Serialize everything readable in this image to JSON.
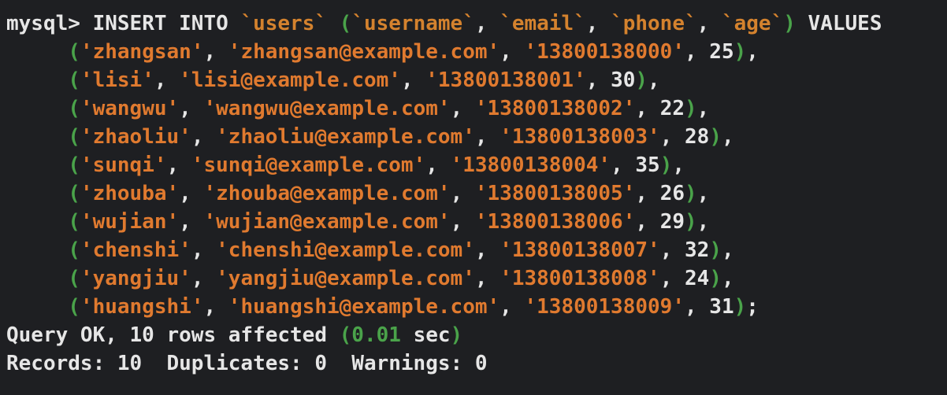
{
  "terminal": {
    "prompt": "mysql>",
    "statement": {
      "insert_keyword": "INSERT INTO",
      "table": "`users`",
      "columns": [
        "`username`",
        "`email`",
        "`phone`",
        "`age`"
      ],
      "values_keyword": "VALUES",
      "continuation": "->",
      "rows": [
        {
          "username": "'zhangsan'",
          "email": "'zhangsan@example.com'",
          "phone": "'13800138000'",
          "age": "25",
          "end": ","
        },
        {
          "username": "'lisi'",
          "email": "'lisi@example.com'",
          "phone": "'13800138001'",
          "age": "30",
          "end": ","
        },
        {
          "username": "'wangwu'",
          "email": "'wangwu@example.com'",
          "phone": "'13800138002'",
          "age": "22",
          "end": ","
        },
        {
          "username": "'zhaoliu'",
          "email": "'zhaoliu@example.com'",
          "phone": "'13800138003'",
          "age": "28",
          "end": ","
        },
        {
          "username": "'sunqi'",
          "email": "'sunqi@example.com'",
          "phone": "'13800138004'",
          "age": "35",
          "end": ","
        },
        {
          "username": "'zhouba'",
          "email": "'zhouba@example.com'",
          "phone": "'13800138005'",
          "age": "26",
          "end": ","
        },
        {
          "username": "'wujian'",
          "email": "'wujian@example.com'",
          "phone": "'13800138006'",
          "age": "29",
          "end": ","
        },
        {
          "username": "'chenshi'",
          "email": "'chenshi@example.com'",
          "phone": "'13800138007'",
          "age": "32",
          "end": ","
        },
        {
          "username": "'yangjiu'",
          "email": "'yangjiu@example.com'",
          "phone": "'13800138008'",
          "age": "24",
          "end": ","
        },
        {
          "username": "'huangshi'",
          "email": "'huangshi@example.com'",
          "phone": "'13800138009'",
          "age": "31",
          "end": ";"
        }
      ]
    },
    "result": {
      "query_ok": "Query OK, 10 rows affected ",
      "time_value": "0.01",
      "time_unit": " sec",
      "records_line": "Records: 10  Duplicates: 0  Warnings: 0"
    }
  },
  "colors": {
    "background": "#1e1f22",
    "text": "#e6e6e6",
    "identifier": "#d4822e",
    "string": "#e07a2f",
    "paren": "#4aa34a"
  }
}
